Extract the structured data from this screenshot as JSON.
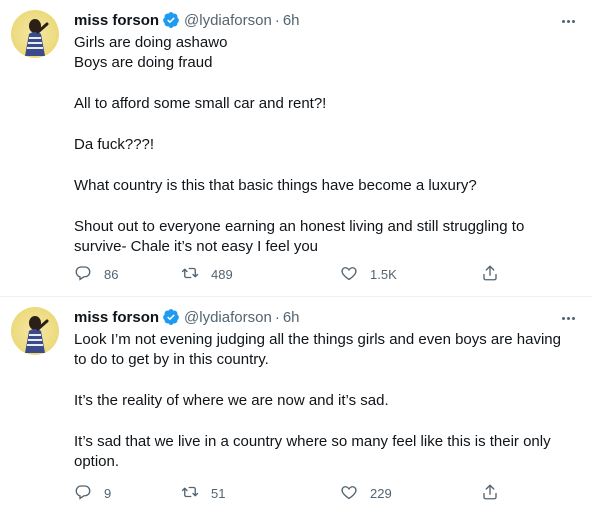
{
  "tweets": [
    {
      "name": "miss forson",
      "handle": "@lydiaforson",
      "time": "6h",
      "lines": [
        "Girls are doing ashawo",
        "Boys are doing fraud",
        "",
        "All to afford some small car and rent?!",
        "",
        "Da fuck???!",
        "",
        "What country is this that basic things have become a luxury?",
        "",
        "Shout out to everyone earning an honest living and still struggling to",
        "survive- Chale it’s not easy I feel you"
      ],
      "replies": "86",
      "retweets": "489",
      "likes": "1.5K"
    },
    {
      "name": "miss forson",
      "handle": "@lydiaforson",
      "time": "6h",
      "lines": [
        "Look I’m not evening judging all the things girls and even boys are having",
        "to do to get by in this country.",
        "",
        "It’s the reality of where we are now and it’s sad.",
        "",
        "It’s sad that we live in a country where so many feel like this is their only",
        "option."
      ],
      "replies": "9",
      "retweets": "51",
      "likes": "229"
    }
  ],
  "colors": {
    "text": "#0f1419",
    "muted": "#536471",
    "verified": "#1d9bf0",
    "divider": "#eff3f4"
  },
  "icons": [
    "verified-badge-icon",
    "more-icon",
    "reply-icon",
    "retweet-icon",
    "like-icon",
    "share-icon"
  ]
}
